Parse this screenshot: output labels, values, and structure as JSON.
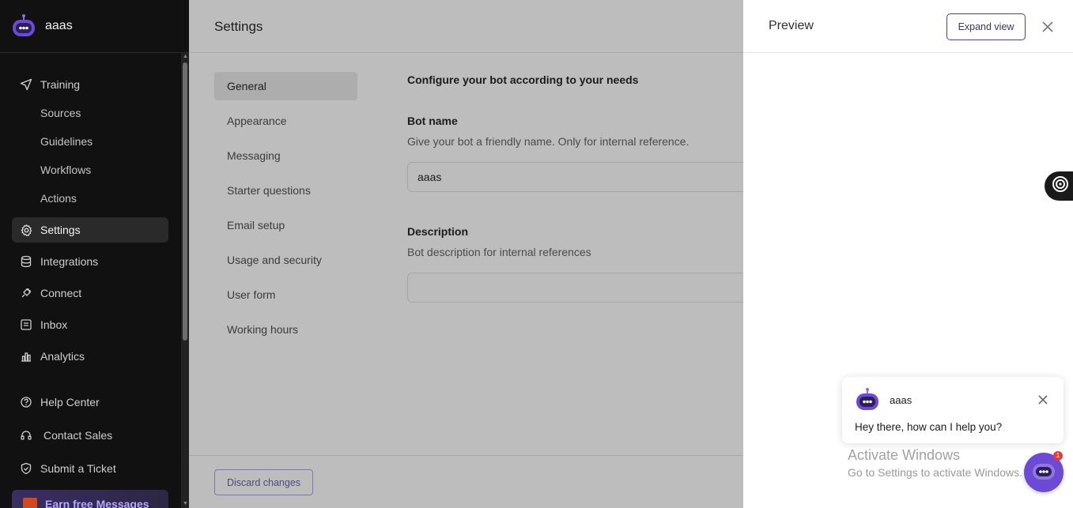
{
  "bot": {
    "name": "aaas"
  },
  "sidebar": {
    "training": "Training",
    "sub_items": [
      "Sources",
      "Guidelines",
      "Workflows",
      "Actions"
    ],
    "items": [
      "Settings",
      "Integrations",
      "Connect",
      "Inbox",
      "Analytics"
    ],
    "help_items": [
      "Help Center",
      "Contact Sales",
      "Submit a Ticket"
    ],
    "earn": "Earn free Messages"
  },
  "settings": {
    "title": "Settings",
    "nav": [
      "General",
      "Appearance",
      "Messaging",
      "Starter questions",
      "Email setup",
      "Usage and security",
      "User form",
      "Working hours"
    ],
    "active_nav": "General",
    "form": {
      "heading": "Configure your bot according to your needs",
      "bot_name_label": "Bot name",
      "bot_name_help": "Give your bot a friendly name. Only for internal reference.",
      "bot_name_value": "aaas",
      "description_label": "Description",
      "description_help": "Bot description for internal references",
      "description_value": ""
    },
    "discard_label": "Discard changes"
  },
  "preview": {
    "title": "Preview",
    "expand_label": "Expand view",
    "chat": {
      "name": "aaas",
      "message": "Hey there, how can I help you?"
    },
    "badge_count": "1"
  },
  "watermark": {
    "line1": "Activate Windows",
    "line2": "Go to Settings to activate Windows."
  },
  "colors": {
    "accent": "#6d4ad6",
    "sidebar_bg": "#111111",
    "overlay": "#bdbdbd"
  }
}
